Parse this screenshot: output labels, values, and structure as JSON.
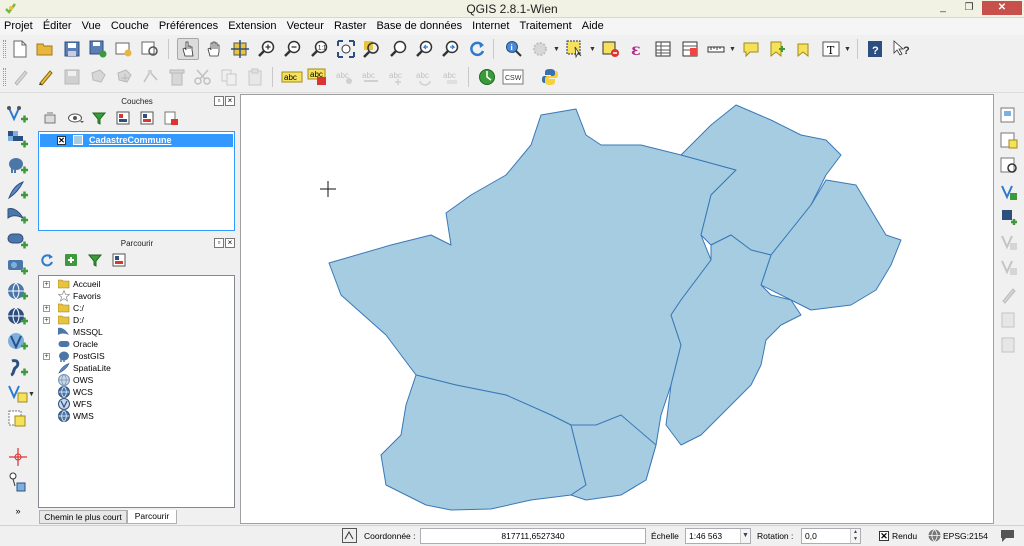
{
  "window": {
    "title": "QGIS 2.8.1-Wien",
    "minimize": "_",
    "maximize": "❐",
    "close": "✕"
  },
  "menu": [
    "Projet",
    "Éditer",
    "Vue",
    "Couche",
    "Préférences",
    "Extension",
    "Vecteur",
    "Raster",
    "Base de données",
    "Internet",
    "Traitement",
    "Aide"
  ],
  "layers_panel": {
    "title": "Couches",
    "layers": [
      {
        "name": "CadastreCommune",
        "checked": true,
        "color": "#a5cce0"
      }
    ]
  },
  "browser_panel": {
    "title": "Parcourir",
    "items": [
      {
        "label": "Accueil",
        "icon": "folder-icon",
        "expandable": true
      },
      {
        "label": "Favoris",
        "icon": "star-icon",
        "expandable": false
      },
      {
        "label": "C:/",
        "icon": "folder-icon",
        "expandable": true
      },
      {
        "label": "D:/",
        "icon": "folder-icon",
        "expandable": true
      },
      {
        "label": "MSSQL",
        "icon": "mssql-icon",
        "expandable": false
      },
      {
        "label": "Oracle",
        "icon": "oracle-icon",
        "expandable": false
      },
      {
        "label": "PostGIS",
        "icon": "postgis-icon",
        "expandable": true
      },
      {
        "label": "SpatiaLite",
        "icon": "spatialite-icon",
        "expandable": false
      },
      {
        "label": "OWS",
        "icon": "globe-icon",
        "expandable": false
      },
      {
        "label": "WCS",
        "icon": "globe-icon",
        "expandable": false
      },
      {
        "label": "WFS",
        "icon": "globe-icon",
        "expandable": false
      },
      {
        "label": "WMS",
        "icon": "globe-icon",
        "expandable": false
      }
    ],
    "tabs": [
      "Chemin le plus court",
      "Parcourir"
    ],
    "active_tab": "Parcourir"
  },
  "status": {
    "coord_label": "Coordonnée :",
    "coord_value": "817711,6527340",
    "scale_label": "Échelle",
    "scale_value": "1:46 563",
    "rotation_label": "Rotation :",
    "rotation_value": "0,0",
    "render_label": "Rendu",
    "render_checked": true,
    "crs": "EPSG:2154"
  },
  "map": {
    "fill": "#a5cce0",
    "stroke": "#3a78b8"
  }
}
